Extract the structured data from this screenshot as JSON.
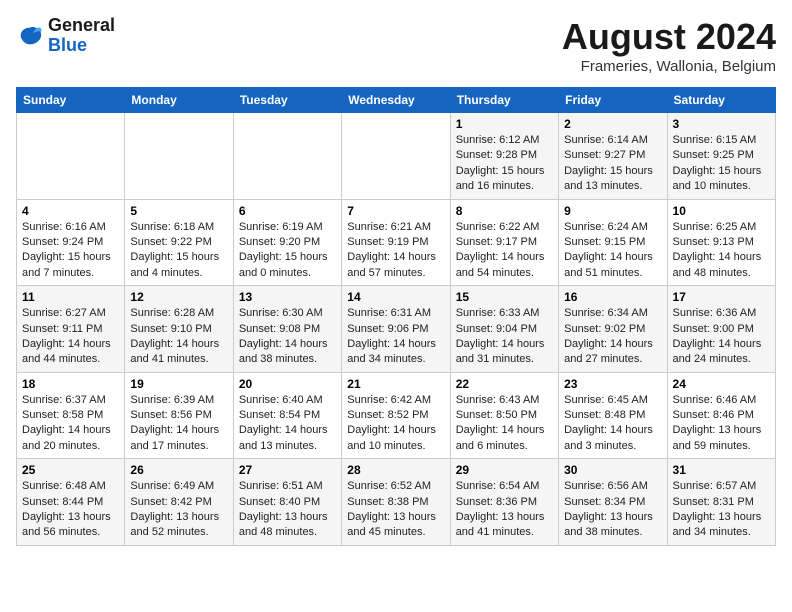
{
  "header": {
    "logo_line1": "General",
    "logo_line2": "Blue",
    "month_title": "August 2024",
    "subtitle": "Frameries, Wallonia, Belgium"
  },
  "weekdays": [
    "Sunday",
    "Monday",
    "Tuesday",
    "Wednesday",
    "Thursday",
    "Friday",
    "Saturday"
  ],
  "weeks": [
    [
      {
        "day": "",
        "info": ""
      },
      {
        "day": "",
        "info": ""
      },
      {
        "day": "",
        "info": ""
      },
      {
        "day": "",
        "info": ""
      },
      {
        "day": "1",
        "info": "Sunrise: 6:12 AM\nSunset: 9:28 PM\nDaylight: 15 hours\nand 16 minutes."
      },
      {
        "day": "2",
        "info": "Sunrise: 6:14 AM\nSunset: 9:27 PM\nDaylight: 15 hours\nand 13 minutes."
      },
      {
        "day": "3",
        "info": "Sunrise: 6:15 AM\nSunset: 9:25 PM\nDaylight: 15 hours\nand 10 minutes."
      }
    ],
    [
      {
        "day": "4",
        "info": "Sunrise: 6:16 AM\nSunset: 9:24 PM\nDaylight: 15 hours\nand 7 minutes."
      },
      {
        "day": "5",
        "info": "Sunrise: 6:18 AM\nSunset: 9:22 PM\nDaylight: 15 hours\nand 4 minutes."
      },
      {
        "day": "6",
        "info": "Sunrise: 6:19 AM\nSunset: 9:20 PM\nDaylight: 15 hours\nand 0 minutes."
      },
      {
        "day": "7",
        "info": "Sunrise: 6:21 AM\nSunset: 9:19 PM\nDaylight: 14 hours\nand 57 minutes."
      },
      {
        "day": "8",
        "info": "Sunrise: 6:22 AM\nSunset: 9:17 PM\nDaylight: 14 hours\nand 54 minutes."
      },
      {
        "day": "9",
        "info": "Sunrise: 6:24 AM\nSunset: 9:15 PM\nDaylight: 14 hours\nand 51 minutes."
      },
      {
        "day": "10",
        "info": "Sunrise: 6:25 AM\nSunset: 9:13 PM\nDaylight: 14 hours\nand 48 minutes."
      }
    ],
    [
      {
        "day": "11",
        "info": "Sunrise: 6:27 AM\nSunset: 9:11 PM\nDaylight: 14 hours\nand 44 minutes."
      },
      {
        "day": "12",
        "info": "Sunrise: 6:28 AM\nSunset: 9:10 PM\nDaylight: 14 hours\nand 41 minutes."
      },
      {
        "day": "13",
        "info": "Sunrise: 6:30 AM\nSunset: 9:08 PM\nDaylight: 14 hours\nand 38 minutes."
      },
      {
        "day": "14",
        "info": "Sunrise: 6:31 AM\nSunset: 9:06 PM\nDaylight: 14 hours\nand 34 minutes."
      },
      {
        "day": "15",
        "info": "Sunrise: 6:33 AM\nSunset: 9:04 PM\nDaylight: 14 hours\nand 31 minutes."
      },
      {
        "day": "16",
        "info": "Sunrise: 6:34 AM\nSunset: 9:02 PM\nDaylight: 14 hours\nand 27 minutes."
      },
      {
        "day": "17",
        "info": "Sunrise: 6:36 AM\nSunset: 9:00 PM\nDaylight: 14 hours\nand 24 minutes."
      }
    ],
    [
      {
        "day": "18",
        "info": "Sunrise: 6:37 AM\nSunset: 8:58 PM\nDaylight: 14 hours\nand 20 minutes."
      },
      {
        "day": "19",
        "info": "Sunrise: 6:39 AM\nSunset: 8:56 PM\nDaylight: 14 hours\nand 17 minutes."
      },
      {
        "day": "20",
        "info": "Sunrise: 6:40 AM\nSunset: 8:54 PM\nDaylight: 14 hours\nand 13 minutes."
      },
      {
        "day": "21",
        "info": "Sunrise: 6:42 AM\nSunset: 8:52 PM\nDaylight: 14 hours\nand 10 minutes."
      },
      {
        "day": "22",
        "info": "Sunrise: 6:43 AM\nSunset: 8:50 PM\nDaylight: 14 hours\nand 6 minutes."
      },
      {
        "day": "23",
        "info": "Sunrise: 6:45 AM\nSunset: 8:48 PM\nDaylight: 14 hours\nand 3 minutes."
      },
      {
        "day": "24",
        "info": "Sunrise: 6:46 AM\nSunset: 8:46 PM\nDaylight: 13 hours\nand 59 minutes."
      }
    ],
    [
      {
        "day": "25",
        "info": "Sunrise: 6:48 AM\nSunset: 8:44 PM\nDaylight: 13 hours\nand 56 minutes."
      },
      {
        "day": "26",
        "info": "Sunrise: 6:49 AM\nSunset: 8:42 PM\nDaylight: 13 hours\nand 52 minutes."
      },
      {
        "day": "27",
        "info": "Sunrise: 6:51 AM\nSunset: 8:40 PM\nDaylight: 13 hours\nand 48 minutes."
      },
      {
        "day": "28",
        "info": "Sunrise: 6:52 AM\nSunset: 8:38 PM\nDaylight: 13 hours\nand 45 minutes."
      },
      {
        "day": "29",
        "info": "Sunrise: 6:54 AM\nSunset: 8:36 PM\nDaylight: 13 hours\nand 41 minutes."
      },
      {
        "day": "30",
        "info": "Sunrise: 6:56 AM\nSunset: 8:34 PM\nDaylight: 13 hours\nand 38 minutes."
      },
      {
        "day": "31",
        "info": "Sunrise: 6:57 AM\nSunset: 8:31 PM\nDaylight: 13 hours\nand 34 minutes."
      }
    ]
  ]
}
